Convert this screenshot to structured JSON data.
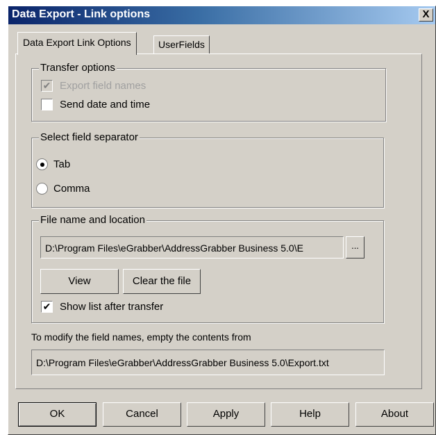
{
  "window": {
    "title": "Data Export - Link options",
    "close_glyph": "X"
  },
  "tabs": [
    {
      "label": "Data Export Link Options",
      "active": true
    },
    {
      "label": "UserFields",
      "active": false
    }
  ],
  "transfer_options": {
    "legend": "Transfer options",
    "export_field_names": {
      "label": "Export field names",
      "checked": true,
      "enabled": false
    },
    "send_date_time": {
      "label": "Send date and time",
      "checked": false,
      "enabled": true
    }
  },
  "separator": {
    "legend": "Select field separator",
    "options": [
      {
        "label": "Tab",
        "selected": true
      },
      {
        "label": "Comma",
        "selected": false
      }
    ]
  },
  "file": {
    "legend": "File name and location",
    "path": "D:\\Program Files\\eGrabber\\AddressGrabber Business 5.0\\E",
    "browse_label": "...",
    "view_label": "View",
    "clear_label": "Clear the file",
    "show_list": {
      "label": "Show list after transfer",
      "checked": true
    }
  },
  "modify_note": "To modify the field names, empty the contents from",
  "export_path": "D:\\Program Files\\eGrabber\\AddressGrabber Business 5.0\\Export.txt",
  "buttons": {
    "ok": "OK",
    "cancel": "Cancel",
    "apply": "Apply",
    "help": "Help",
    "about": "About"
  },
  "check_glyph": "✔"
}
